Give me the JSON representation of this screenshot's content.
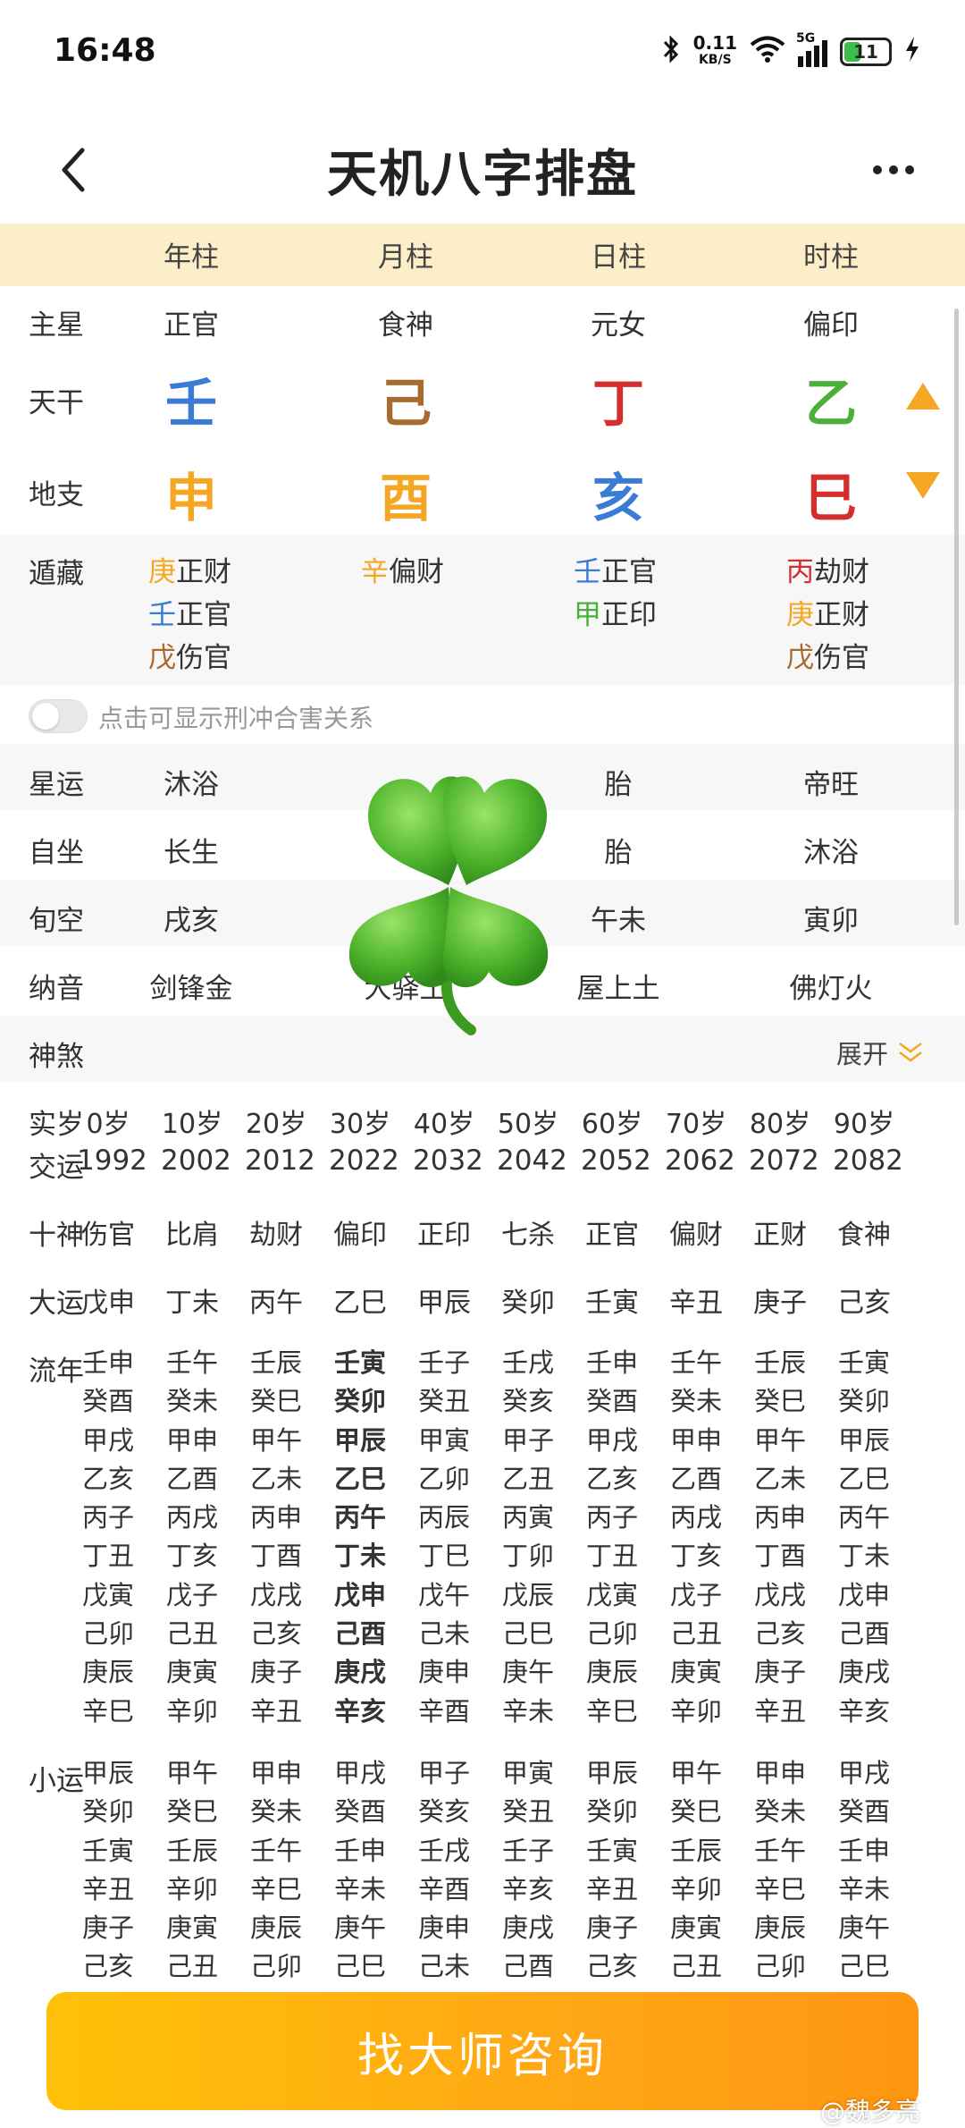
{
  "status_bar": {
    "time": "16:48",
    "net_speed": "0.11",
    "net_unit": "KB/S",
    "network": "5G",
    "battery": "11"
  },
  "header": {
    "title": "天机八字排盘"
  },
  "pillars": {
    "headers": [
      "年柱",
      "月柱",
      "日柱",
      "时柱"
    ]
  },
  "rows": {
    "main_star": {
      "label": "主星",
      "values": [
        "正官",
        "食神",
        "元女",
        "偏印"
      ]
    },
    "heavenly_stem": {
      "label": "天干",
      "values": [
        "壬",
        "己",
        "丁",
        "乙"
      ],
      "colors": [
        "#3a7bd5",
        "#a86a2e",
        "#d32f2f",
        "#4caf3a"
      ]
    },
    "earthly_branch": {
      "label": "地支",
      "values": [
        "申",
        "酉",
        "亥",
        "巳"
      ],
      "colors": [
        "#f5a623",
        "#f5a623",
        "#3a7bd5",
        "#d32f2f"
      ]
    },
    "hidden": {
      "label": "遁藏",
      "columns": [
        [
          {
            "stem": "庚",
            "god": "正财",
            "color": "#f5a623"
          },
          {
            "stem": "壬",
            "god": "正官",
            "color": "#3a7bd5"
          },
          {
            "stem": "戊",
            "god": "伤官",
            "color": "#a86a2e"
          }
        ],
        [
          {
            "stem": "辛",
            "god": "偏财",
            "color": "#f5a623"
          }
        ],
        [
          {
            "stem": "壬",
            "god": "正官",
            "color": "#3a7bd5"
          },
          {
            "stem": "甲",
            "god": "正印",
            "color": "#4caf3a"
          }
        ],
        [
          {
            "stem": "丙",
            "god": "劫财",
            "color": "#d32f2f"
          },
          {
            "stem": "庚",
            "god": "正财",
            "color": "#f5a623"
          },
          {
            "stem": "戊",
            "god": "伤官",
            "color": "#a86a2e"
          }
        ]
      ]
    },
    "toggle_label": "点击可显示刑冲合害关系",
    "star_fortune": {
      "label": "星运",
      "values": [
        "沐浴",
        "",
        "胎",
        "帝旺"
      ]
    },
    "self_seat": {
      "label": "自坐",
      "values": [
        "长生",
        "",
        "胎",
        "沐浴"
      ]
    },
    "void": {
      "label": "旬空",
      "values": [
        "戌亥",
        "",
        "午未",
        "寅卯"
      ]
    },
    "nayin": {
      "label": "纳音",
      "values": [
        "剑锋金",
        "大驿土",
        "屋上土",
        "佛灯火"
      ]
    },
    "shensha": {
      "label": "神煞",
      "expand": "展开"
    }
  },
  "dayun": {
    "age_label": "实岁",
    "ages": [
      "0岁",
      "10岁",
      "20岁",
      "30岁",
      "40岁",
      "50岁",
      "60岁",
      "70岁",
      "80岁",
      "90岁"
    ],
    "start_label": "交运",
    "years": [
      "1992",
      "2002",
      "2012",
      "2022",
      "2032",
      "2042",
      "2052",
      "2062",
      "2072",
      "2082"
    ],
    "gods_label": "十神",
    "gods": [
      "伤官",
      "比肩",
      "劫财",
      "偏印",
      "正印",
      "七杀",
      "正官",
      "偏财",
      "正财",
      "食神"
    ],
    "dayun_label": "大运",
    "dayun": [
      "戊申",
      "丁未",
      "丙午",
      "乙巳",
      "甲辰",
      "癸卯",
      "壬寅",
      "辛丑",
      "庚子",
      "己亥"
    ],
    "liunian_label": "流年",
    "liunian": [
      [
        "壬申",
        "癸酉",
        "甲戌",
        "乙亥",
        "丙子",
        "丁丑",
        "戊寅",
        "己卯",
        "庚辰",
        "辛巳"
      ],
      [
        "壬午",
        "癸未",
        "甲申",
        "乙酉",
        "丙戌",
        "丁亥",
        "戊子",
        "己丑",
        "庚寅",
        "辛卯"
      ],
      [
        "壬辰",
        "癸巳",
        "甲午",
        "乙未",
        "丙申",
        "丁酉",
        "戊戌",
        "己亥",
        "庚子",
        "辛丑"
      ],
      [
        "壬寅",
        "癸卯",
        "甲辰",
        "乙巳",
        "丙午",
        "丁未",
        "戊申",
        "己酉",
        "庚戌",
        "辛亥"
      ],
      [
        "壬子",
        "癸丑",
        "甲寅",
        "乙卯",
        "丙辰",
        "丁巳",
        "戊午",
        "己未",
        "庚申",
        "辛酉"
      ],
      [
        "壬戌",
        "癸亥",
        "甲子",
        "乙丑",
        "丙寅",
        "丁卯",
        "戊辰",
        "己巳",
        "庚午",
        "辛未"
      ],
      [
        "壬申",
        "癸酉",
        "甲戌",
        "乙亥",
        "丙子",
        "丁丑",
        "戊寅",
        "己卯",
        "庚辰",
        "辛巳"
      ],
      [
        "壬午",
        "癸未",
        "甲申",
        "乙酉",
        "丙戌",
        "丁亥",
        "戊子",
        "己丑",
        "庚寅",
        "辛卯"
      ],
      [
        "壬辰",
        "癸巳",
        "甲午",
        "乙未",
        "丙申",
        "丁酉",
        "戊戌",
        "己亥",
        "庚子",
        "辛丑"
      ],
      [
        "壬寅",
        "癸卯",
        "甲辰",
        "乙巳",
        "丙午",
        "丁未",
        "戊申",
        "己酉",
        "庚戌",
        "辛亥"
      ]
    ],
    "xiaoyun_label": "小运",
    "xiaoyun": [
      [
        "甲辰",
        "癸卯",
        "壬寅",
        "辛丑",
        "庚子",
        "己亥"
      ],
      [
        "甲午",
        "癸巳",
        "壬辰",
        "辛卯",
        "庚寅",
        "己丑"
      ],
      [
        "甲申",
        "癸未",
        "壬午",
        "辛巳",
        "庚辰",
        "己卯"
      ],
      [
        "甲戌",
        "癸酉",
        "壬申",
        "辛未",
        "庚午",
        "己巳"
      ],
      [
        "甲子",
        "癸亥",
        "壬戌",
        "辛酉",
        "庚申",
        "己未"
      ],
      [
        "甲寅",
        "癸丑",
        "壬子",
        "辛亥",
        "庚戌",
        "己酉"
      ],
      [
        "甲辰",
        "癸卯",
        "壬寅",
        "辛丑",
        "庚子",
        "己亥"
      ],
      [
        "甲午",
        "癸巳",
        "壬辰",
        "辛卯",
        "庚寅",
        "己丑"
      ],
      [
        "甲申",
        "癸未",
        "壬午",
        "辛巳",
        "庚辰",
        "己卯"
      ],
      [
        "甲戌",
        "癸酉",
        "壬申",
        "辛未",
        "庚午",
        "己巳"
      ]
    ]
  },
  "cta": {
    "label": "找大师咨询"
  },
  "watermark": "@魏多亮",
  "icons": [
    "back-arrow-icon",
    "more-dots-icon",
    "arrow-up-icon",
    "arrow-down-icon",
    "chevron-down-icon",
    "clover-sticker",
    "bluetooth-icon",
    "wifi-icon",
    "signal-icon",
    "battery-icon",
    "charging-icon"
  ],
  "colors": {
    "accent": "#ffa716",
    "pillar_header_bg": "#fbeec9",
    "arrow": "#f5a623"
  }
}
